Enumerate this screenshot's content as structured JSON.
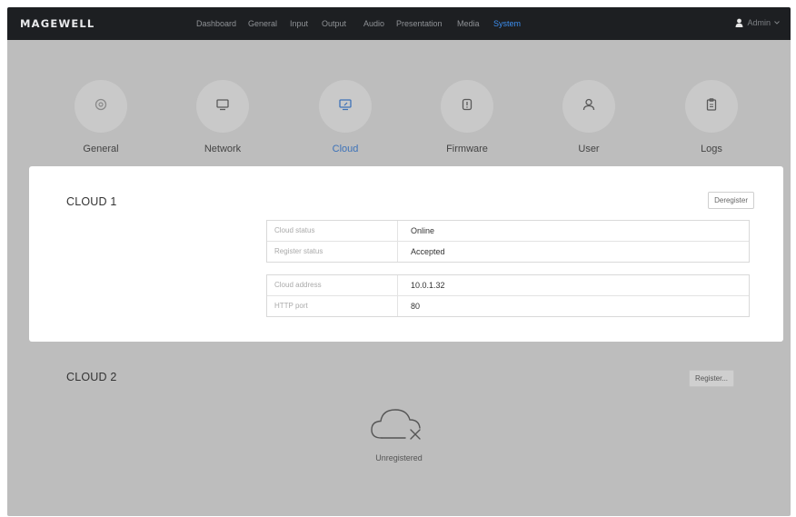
{
  "brand": {
    "logo": "MAGEWELL"
  },
  "nav": {
    "items": [
      {
        "label": "Dashboard",
        "active": false
      },
      {
        "label": "General",
        "active": false
      },
      {
        "label": "Input",
        "active": false
      },
      {
        "label": "Output",
        "active": false
      },
      {
        "label": "Audio",
        "active": false
      },
      {
        "label": "Presentation",
        "active": false
      },
      {
        "label": "Media",
        "active": false
      },
      {
        "label": "System",
        "active": true
      }
    ],
    "user": {
      "label": "Admin",
      "icon": "user-icon"
    }
  },
  "system_tabs": [
    {
      "label": "General",
      "icon": "gear-icon",
      "active": false
    },
    {
      "label": "Network",
      "icon": "monitor-icon",
      "active": false
    },
    {
      "label": "Cloud",
      "icon": "cloud-monitor-icon",
      "active": true
    },
    {
      "label": "Firmware",
      "icon": "firmware-icon",
      "active": false
    },
    {
      "label": "User",
      "icon": "user-icon",
      "active": false
    },
    {
      "label": "Logs",
      "icon": "clipboard-icon",
      "active": false
    }
  ],
  "cloud1": {
    "title": "CLOUD 1",
    "button_label": "Deregister",
    "status_rows": [
      {
        "key": "Cloud status",
        "value": "Online"
      },
      {
        "key": "Register status",
        "value": "Accepted"
      }
    ],
    "address_rows": [
      {
        "key": "Cloud address",
        "value": "10.0.1.32"
      },
      {
        "key": "HTTP port",
        "value": "80"
      }
    ]
  },
  "cloud2": {
    "title": "CLOUD 2",
    "button_label": "Register...",
    "empty_label": "Unregistered",
    "empty_icon": "cloud-x-icon"
  },
  "colors": {
    "topbar": "#1d1f22",
    "accent": "#3d8ff0",
    "overlay_gray": "#bdbdbd"
  }
}
